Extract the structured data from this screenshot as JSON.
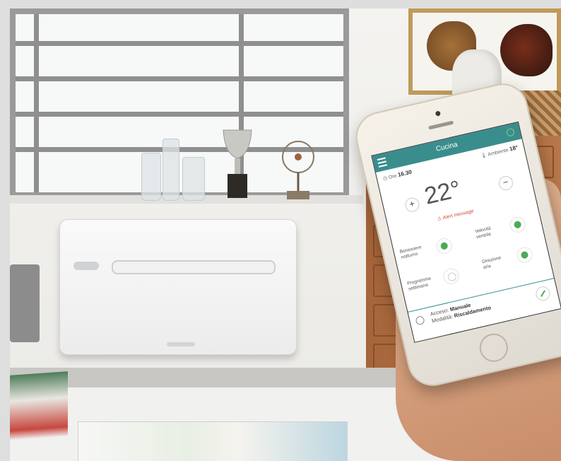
{
  "app": {
    "title": "Cucina",
    "time_label": "Ore",
    "time_value": "16.30",
    "ambient_label": "Ambiente",
    "ambient_value": "18°",
    "set_temperature": "22°",
    "plus_label": "+",
    "minus_label": "−",
    "alert": "Alert message",
    "controls": {
      "night_comfort": "Benessere notturno",
      "fan_speed": "Velocità ventola",
      "weekly_program": "Programma settimana",
      "air_direction": "Direzione aria"
    },
    "status": {
      "on_label": "Acceso:",
      "on_value": "Manuale",
      "mode_label": "Modalità:",
      "mode_value": "Riscaldamento"
    }
  },
  "colors": {
    "header_teal": "#3a8d8d",
    "icon_green": "#4caa52",
    "alert_red": "#d24a3a"
  },
  "icons": [
    "menu-icon",
    "power-icon",
    "clock-icon",
    "thermometer-icon",
    "plus-icon",
    "minus-icon",
    "warning-icon",
    "moon-icon",
    "fan-icon",
    "calendar-icon",
    "direction-icon",
    "sun-icon",
    "edit-icon"
  ]
}
